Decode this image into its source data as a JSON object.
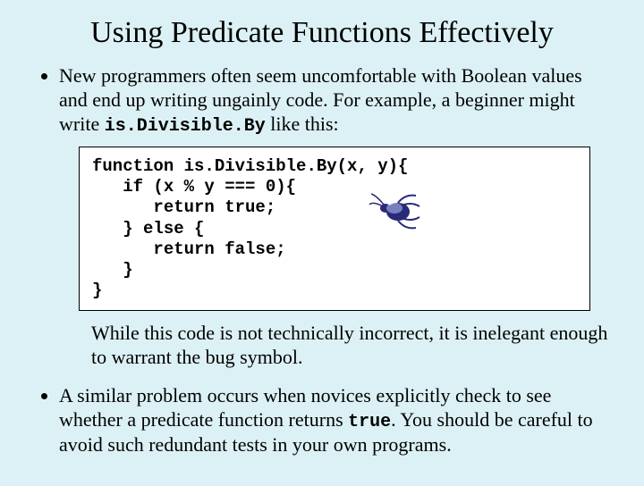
{
  "title": "Using Predicate Functions Effectively",
  "bullet1_a": "New programmers often seem uncomfortable with Boolean values and end up writing ungainly code.  For example, a beginner might write ",
  "bullet1_fn": "is.Divisible.By",
  "bullet1_b": " like this:",
  "code": "function is.Divisible.By(x, y){\n   if (x % y === 0){\n      return true;\n   } else {\n      return false;\n   }\n}",
  "followup": "While this code is not technically incorrect, it is inelegant enough to warrant the bug symbol.",
  "bullet2_a": "A similar problem occurs when novices explicitly check to see whether a predicate function returns ",
  "bullet2_true": "true",
  "bullet2_b": ".  You should be careful to avoid such redundant tests in your own programs.",
  "icon": "bug-icon"
}
